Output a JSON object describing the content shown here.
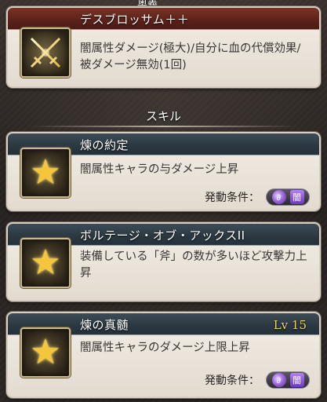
{
  "top_partial_label": "奥義",
  "ougi": {
    "title": "デスブロッサム＋＋",
    "desc": "闇属性ダメージ(極大)/自分に血の代償効果/被ダメージ無効(1回)",
    "icon": "crossed-swords-icon"
  },
  "section": {
    "title": "スキル"
  },
  "skills": [
    {
      "title": "煉の約定",
      "desc": "闇属性キャラの与ダメージ上昇",
      "icon": "star-icon",
      "condition_label": "発動条件：",
      "condition_chip": "闇"
    },
    {
      "title": "ボルテージ・オブ・アックスII",
      "desc": "装備している「斧」の数が多いほど攻撃力上昇",
      "icon": "star-icon"
    },
    {
      "title": "煉の真髄",
      "level": "Lv 15",
      "desc": "闇属性キャラのダメージ上限上昇",
      "icon": "star-icon",
      "condition_label": "発動条件：",
      "condition_chip": "闇"
    }
  ],
  "colors": {
    "skill_header": "#2b3841",
    "ougi_header": "#5c2119",
    "level_text": "#f2d45a",
    "dark_element": "#8a4fd6"
  }
}
